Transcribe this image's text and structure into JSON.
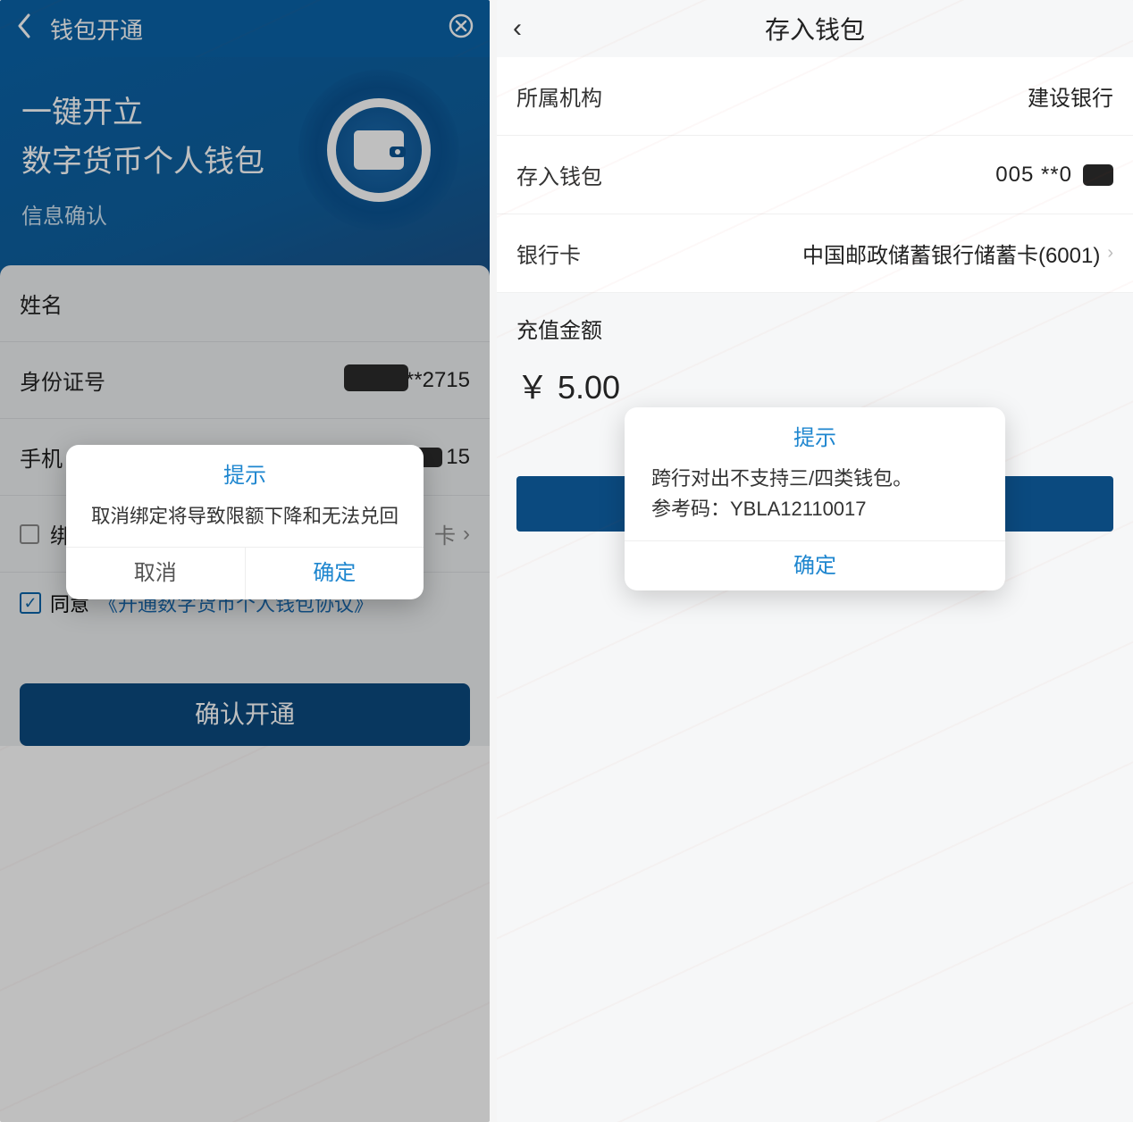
{
  "left": {
    "header": {
      "title": "钱包开通"
    },
    "hero": {
      "line1": "一键开立",
      "line2": "数字货币个人钱包",
      "line3": "信息确认"
    },
    "form": {
      "name_label": "姓名",
      "id_label": "身份证号",
      "id_value": "4210***2715",
      "phone_label": "手机",
      "phone_value_tail": "15",
      "bind_card_label_tail": "卡",
      "agree_label": "同意",
      "agreement_link": "《开通数字货币个人钱包协议》",
      "confirm_btn": "确认开通"
    },
    "dialog": {
      "title": "提示",
      "body": "取消绑定将导致限额下降和无法兑回",
      "cancel": "取消",
      "ok": "确定"
    }
  },
  "right": {
    "header": {
      "title": "存入钱包"
    },
    "rows": {
      "org_label": "所属机构",
      "org_value": "建设银行",
      "wallet_label": "存入钱包",
      "wallet_value": "005   **0",
      "card_label": "银行卡",
      "card_value": "中国邮政储蓄银行储蓄卡(6001)"
    },
    "amount": {
      "label": "充值金额",
      "value": "￥ 5.00"
    },
    "dialog": {
      "title": "提示",
      "body_line1": "跨行对出不支持三/四类钱包。",
      "body_line2": "参考码：YBLA12110017",
      "ok": "确定"
    }
  }
}
